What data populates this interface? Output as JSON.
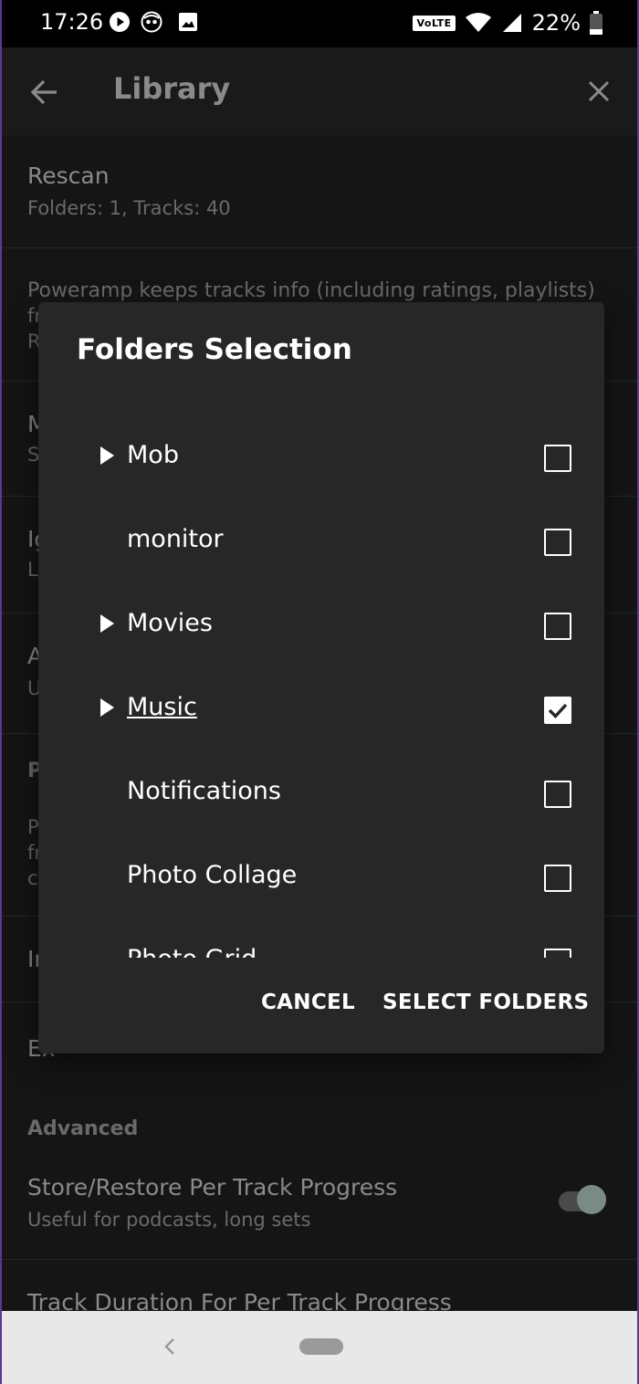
{
  "status_bar": {
    "time": "17:26",
    "icons": [
      "play-icon",
      "app-notification-icon",
      "image-icon"
    ],
    "network_label": "VoLTE",
    "battery": "22%"
  },
  "app_bar": {
    "title": "Library"
  },
  "background_list": {
    "rescan": {
      "title": "Rescan",
      "subtitle": "Folders: 1, Tracks: 40"
    },
    "keep_info": {
      "text": "Poweramp keeps tracks info (including ratings, playlists)",
      "line2": "fr",
      "line3": "R"
    },
    "item_m": {
      "title": "M",
      "subtitle": "S"
    },
    "item_ig": {
      "title": "Ig",
      "subtitle": "L"
    },
    "item_a": {
      "title": "A",
      "subtitle": "U"
    },
    "section_p": {
      "title": "P",
      "line1": "P",
      "line2": "fr",
      "line3": "c"
    },
    "item_in": {
      "title": "In"
    },
    "item_ex": {
      "title": "Ex"
    },
    "advanced_header": "Advanced",
    "store_restore": {
      "title": "Store/Restore Per Track Progress",
      "subtitle": "Useful for podcasts, long sets",
      "toggle_on": true
    },
    "track_duration": {
      "title": "Track Duration For Per Track Progress"
    }
  },
  "dialog": {
    "title": "Folders Selection",
    "folders": [
      {
        "name": "Mob",
        "expandable": true,
        "checked": false
      },
      {
        "name": "monitor",
        "expandable": false,
        "checked": false
      },
      {
        "name": "Movies",
        "expandable": true,
        "checked": false
      },
      {
        "name": "Music",
        "expandable": true,
        "checked": true
      },
      {
        "name": "Notifications",
        "expandable": false,
        "checked": false
      },
      {
        "name": "Photo Collage",
        "expandable": false,
        "checked": false
      },
      {
        "name": "Photo Grid",
        "expandable": false,
        "checked": false
      }
    ],
    "cancel_label": "CANCEL",
    "select_label": "SELECT FOLDERS"
  },
  "colors": {
    "dialog_bg": "#272727",
    "app_bg": "#151515",
    "navbar_bg": "#e8e8e8"
  }
}
